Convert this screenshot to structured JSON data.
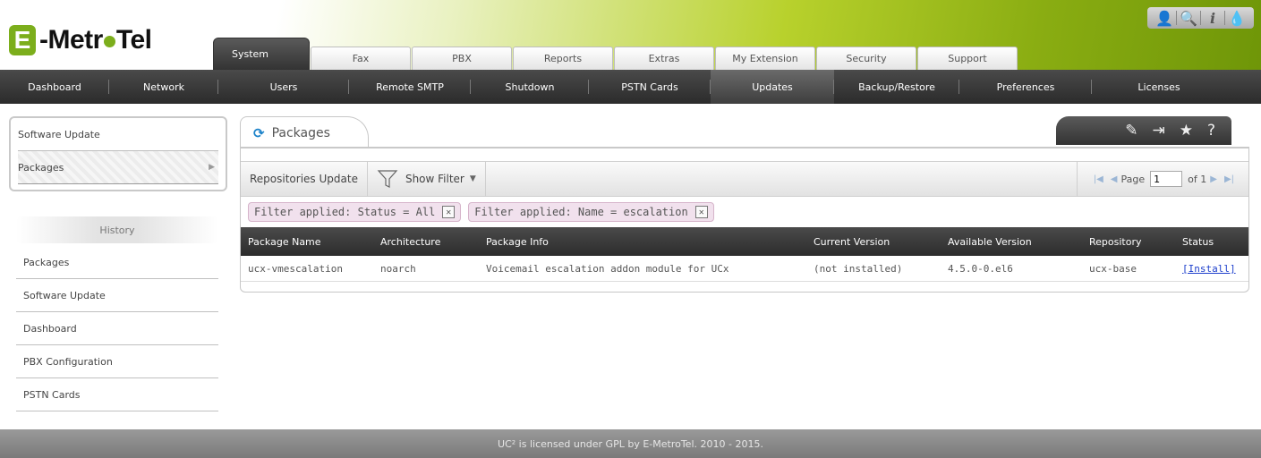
{
  "header": {
    "logo": {
      "letter": "E",
      "text_a": "-Metr",
      "text_b": "Tel"
    },
    "top_icons": [
      "user-icon",
      "search-icon",
      "info-icon",
      "drop-icon"
    ],
    "top_icon_glyphs": {
      "user": "👤",
      "search": "🔍",
      "info": "i",
      "drop": "💧"
    },
    "main_tabs": [
      "System",
      "Fax",
      "PBX",
      "Reports",
      "Extras",
      "My Extension",
      "Security",
      "Support"
    ],
    "active_main_tab": "System"
  },
  "sub_nav": {
    "items": [
      "Dashboard",
      "Network",
      "Users",
      "Remote SMTP",
      "Shutdown",
      "PSTN Cards",
      "Updates",
      "Backup/Restore",
      "Preferences",
      "Licenses"
    ],
    "active": "Updates"
  },
  "left_panel": {
    "items": [
      "Software Update",
      "Packages"
    ],
    "selected": "Packages"
  },
  "history": {
    "title": "History",
    "items": [
      "Packages",
      "Software Update",
      "Dashboard",
      "PBX Configuration",
      "PSTN Cards"
    ]
  },
  "content": {
    "tab_title": "Packages",
    "window_tools": [
      "edit-icon",
      "pin-icon",
      "star-icon",
      "help-icon"
    ],
    "toolbar": {
      "repositories_update": "Repositories Update",
      "show_filter": "Show Filter",
      "page_label": "Page",
      "page_value": "1",
      "of_label": "of 1"
    },
    "filters": [
      "Filter applied: Status = All",
      "Filter applied: Name = escalation"
    ],
    "table": {
      "columns": [
        "Package Name",
        "Architecture",
        "Package Info",
        "Current Version",
        "Available Version",
        "Repository",
        "Status"
      ],
      "rows": [
        [
          "ucx-vmescalation",
          "noarch",
          "Voicemail escalation addon module for UCx",
          "(not installed)",
          "4.5.0-0.el6",
          "ucx-base",
          "[Install]"
        ]
      ]
    }
  },
  "footer": {
    "text": "UC² is licensed under GPL by E-MetroTel. 2010 - 2015."
  },
  "colors": {
    "brand_green": "#7cae1c",
    "nav_dark": "#333333",
    "link_blue": "#1d3fcc",
    "filter_chip": "#f1e1ed"
  }
}
